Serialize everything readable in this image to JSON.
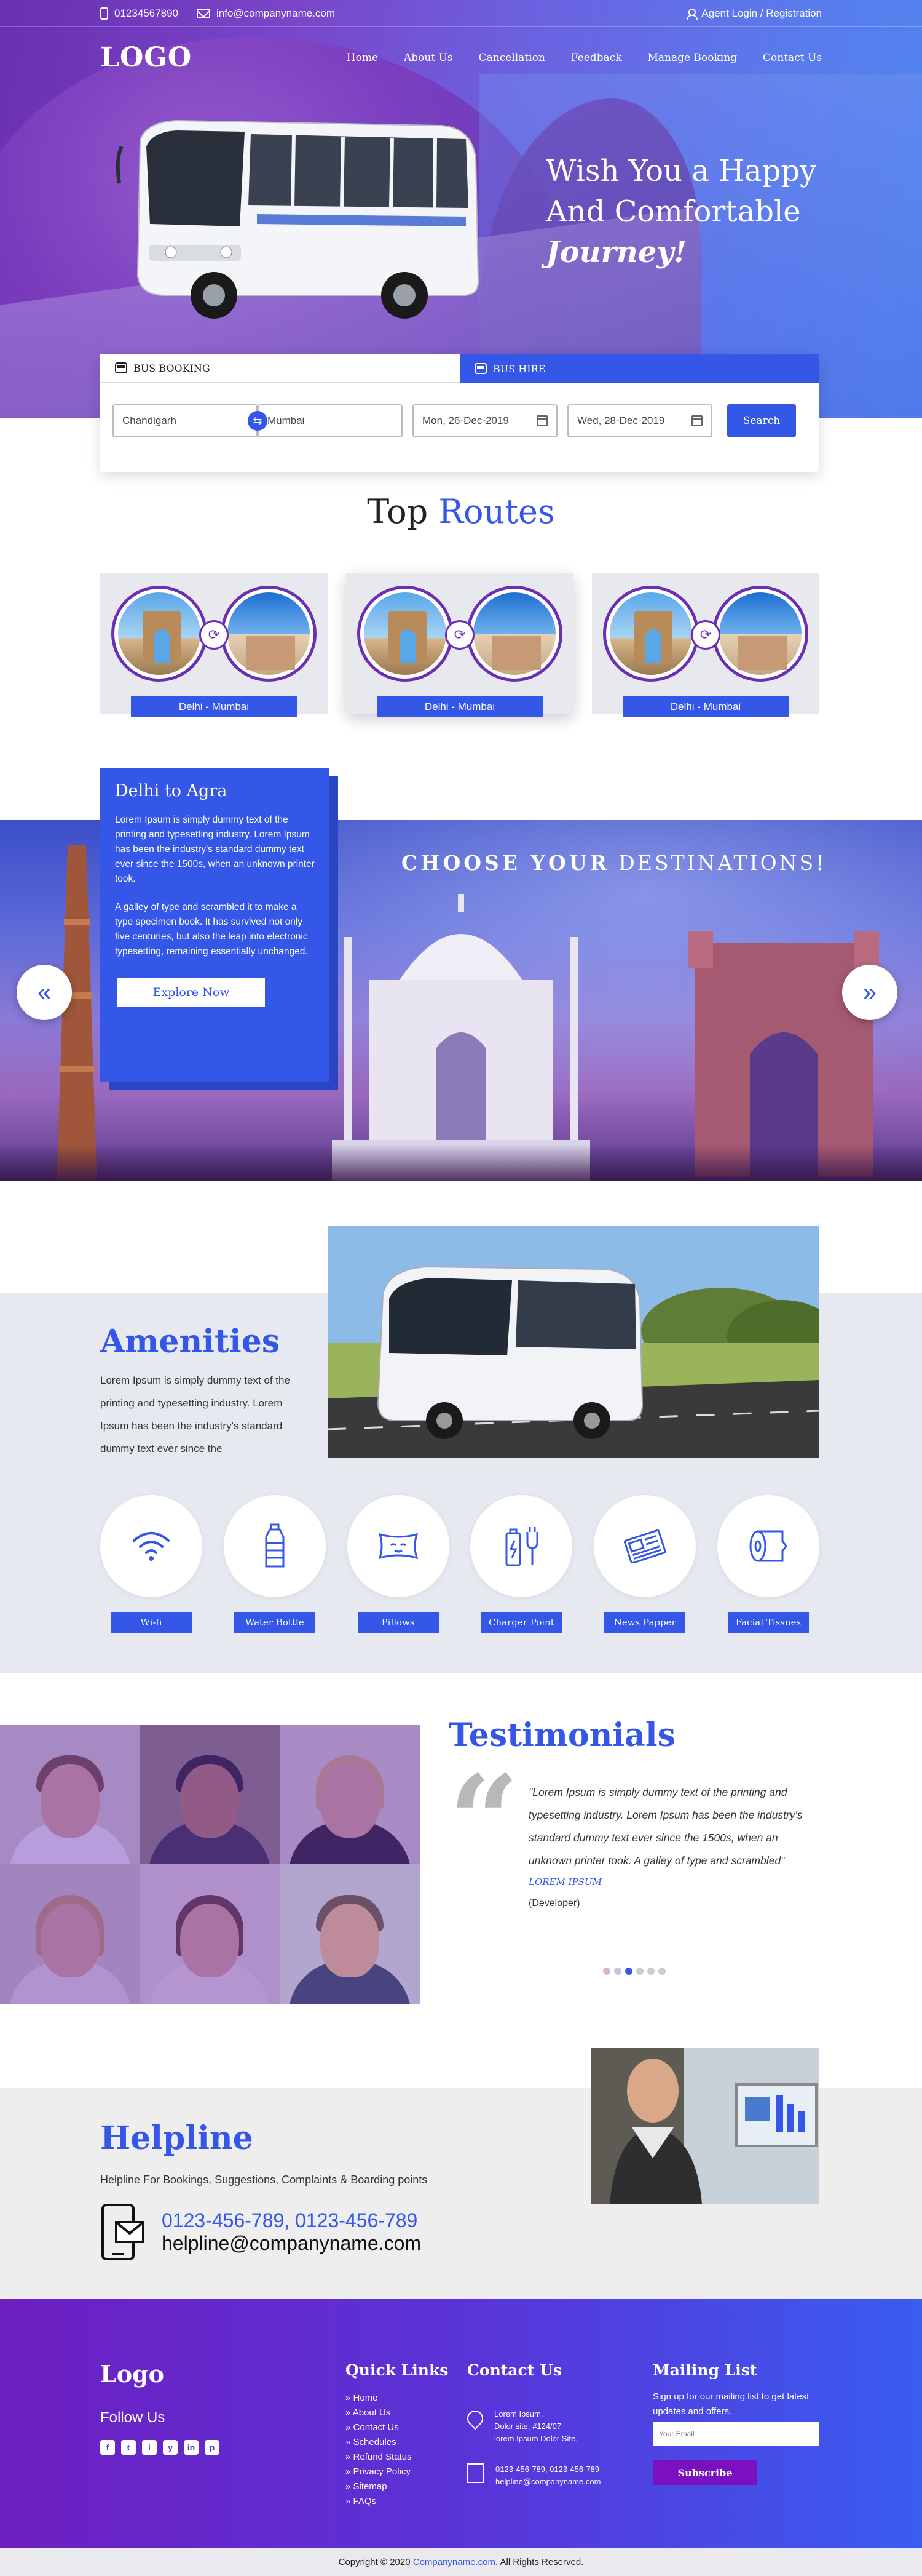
{
  "topbar": {
    "phone": "01234567890",
    "email": "info@companyname.com",
    "login": "Agent Login / Registration"
  },
  "nav": {
    "logo": "LOGO",
    "menu": [
      "Home",
      "About Us",
      "Cancellation",
      "Feedback",
      "Manage Booking",
      "Contact Us"
    ]
  },
  "hero": {
    "line1": "Wish You a Happy",
    "line2": "And Comfortable",
    "line3": "Journey!"
  },
  "booking": {
    "tab_booking": "BUS BOOKING",
    "tab_hire": "BUS HIRE",
    "from": "Chandigarh",
    "to": "Mumbai",
    "depart": "Mon, 26-Dec-2019",
    "return": "Wed, 28-Dec-2019",
    "search_label": "Search"
  },
  "routes": {
    "title_plain": "Top",
    "title_accent": "Routes",
    "items": [
      {
        "label": "Delhi - Mumbai"
      },
      {
        "label": "Delhi - Mumbai"
      },
      {
        "label": "Delhi - Mumbai"
      }
    ]
  },
  "destinations": {
    "heading_bold": "CHOOSE YOUR",
    "heading_rest": "DESTINATIONS!",
    "card_title": "Delhi to Agra",
    "card_p1": "Lorem Ipsum is simply dummy text of the printing and typesetting industry. Lorem Ipsum has been the industry's standard dummy text ever since the 1500s, when an unknown printer took.",
    "card_p2": "A galley of type and scrambled it to make a type specimen book. It has survived not only five centuries, but also the leap into electronic typesetting, remaining essentially unchanged.",
    "explore_label": "Explore Now",
    "prev_glyph": "«",
    "next_glyph": "»"
  },
  "amenities": {
    "title": "Amenities",
    "text": "Lorem Ipsum is simply dummy text of the printing and typesetting industry. Lorem Ipsum has been the industry's standard dummy text ever since the",
    "items": [
      {
        "label": "Wi-fi",
        "icon": "wifi-icon"
      },
      {
        "label": "Water Bottle",
        "icon": "water-bottle-icon"
      },
      {
        "label": "Pillows",
        "icon": "pillow-icon"
      },
      {
        "label": "Charger Point",
        "icon": "charger-icon"
      },
      {
        "label": "News Papper",
        "icon": "newspaper-icon"
      },
      {
        "label": "Facial Tissues",
        "icon": "tissue-icon"
      }
    ]
  },
  "testimonials": {
    "title": "Testimonials",
    "quote": "\"Lorem Ipsum is simply dummy text of the printing and typesetting industry. Lorem Ipsum has been the industry's standard dummy text ever since the 1500s, when an unknown printer took. A galley of type and scrambled\"",
    "author": "LOREM IPSUM",
    "role": "(Developer)",
    "slide_count": 6,
    "active_slide": 2
  },
  "helpline": {
    "title": "Helpline",
    "subtitle": "Helpline For Bookings, Suggestions, Complaints & Boarding points",
    "phones": "0123-456-789, 0123-456-789",
    "email": "helpline@companyname.com"
  },
  "footer": {
    "logo": "Logo",
    "follow": "Follow Us",
    "socials": [
      "f",
      "t",
      "i",
      "y",
      "in",
      "p"
    ],
    "quick_title": "Quick Links",
    "quick_links": [
      "Home",
      "About Us",
      "Contact Us",
      "Schedules",
      "Refund Status",
      "Privacy Policy",
      "Sitemap",
      "FAQs"
    ],
    "contact_title": "Contact Us",
    "address": [
      "Lorem Ipsum,",
      "Dolor site, #124/07",
      "lorem Ipsum Dolor Site."
    ],
    "contact_phones": "0123-456-789, 0123-456-789",
    "contact_email": "helpline@companyname.com",
    "mailing_title": "Mailing List",
    "mailing_text": "Sign up for our mailing list to get latest updates and offers.",
    "email_placeholder": "Your Email",
    "subscribe_label": "Subscribe",
    "copyright_pre": "Copyright © 2020",
    "copyright_site": "Companyname.com",
    "copyright_post": ". All Rights Reserved."
  },
  "colors": {
    "accent": "#3457e8",
    "purple": "#6b2fb1",
    "footer_start": "#6e1fc0",
    "footer_end": "#3a5cf0"
  }
}
